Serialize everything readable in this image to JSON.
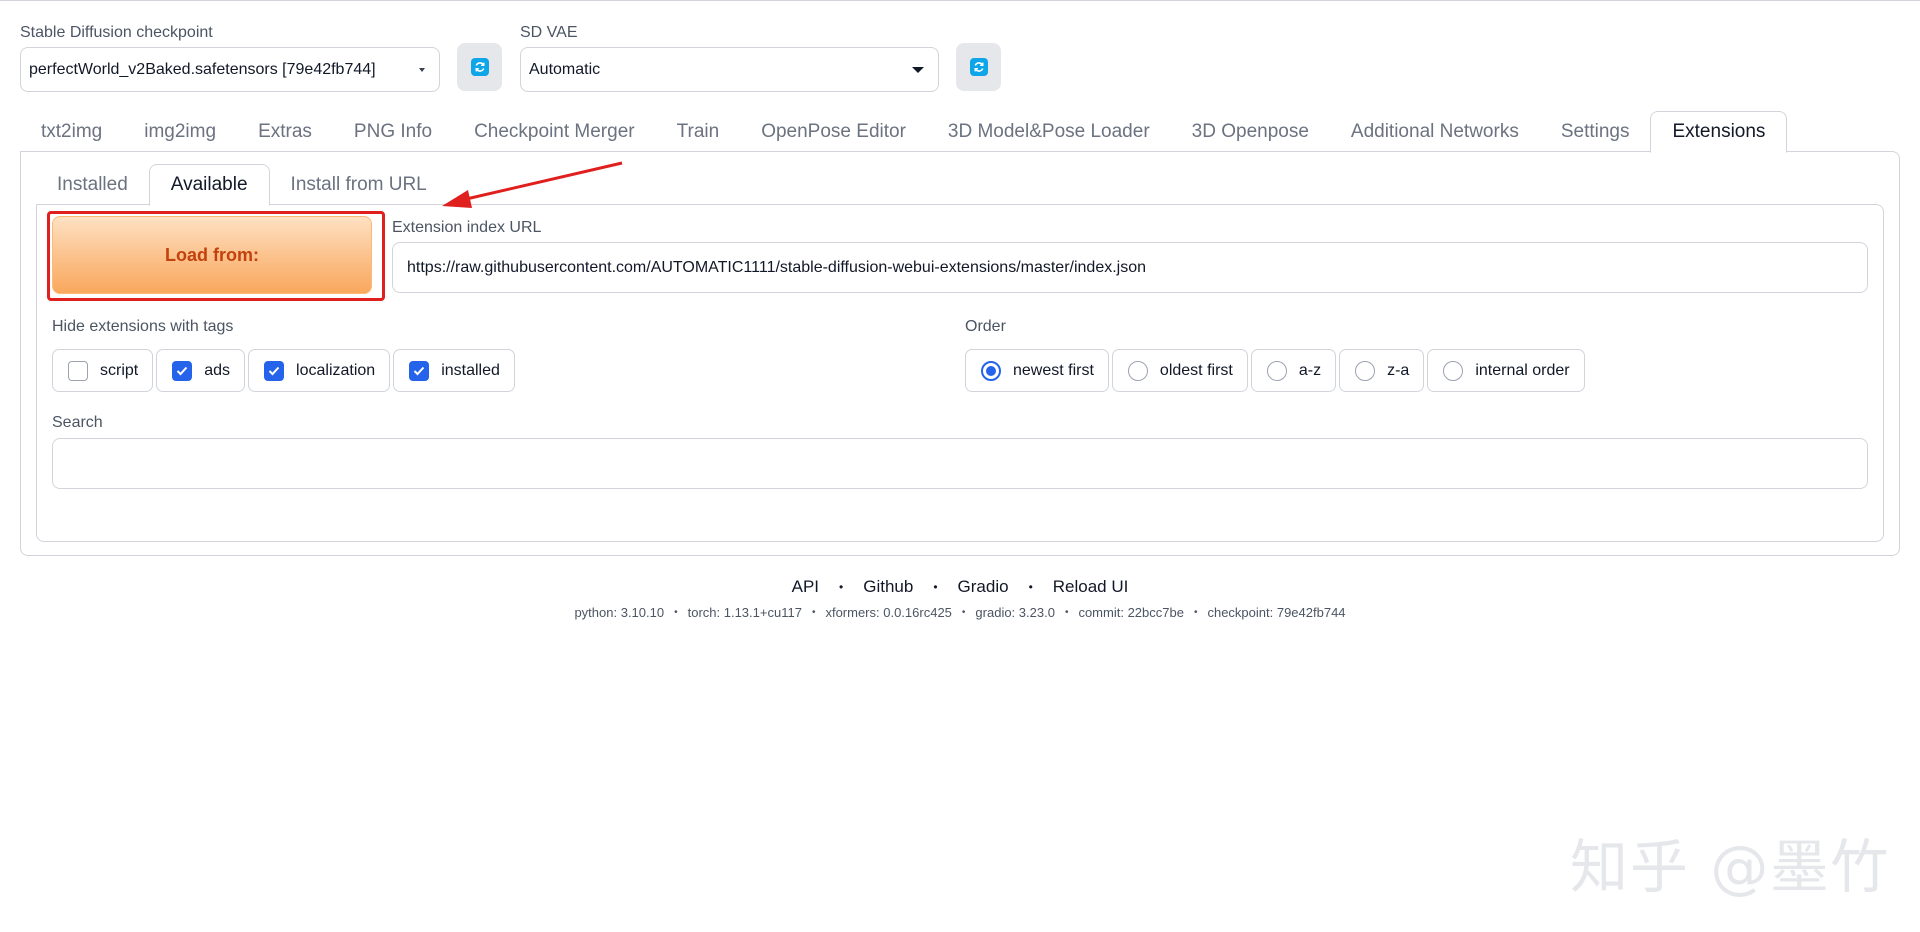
{
  "checkpoint": {
    "label": "Stable Diffusion checkpoint",
    "value": "perfectWorld_v2Baked.safetensors [79e42fb744]"
  },
  "vae": {
    "label": "SD VAE",
    "value": "Automatic"
  },
  "main_tabs": [
    "txt2img",
    "img2img",
    "Extras",
    "PNG Info",
    "Checkpoint Merger",
    "Train",
    "OpenPose Editor",
    "3D Model&Pose Loader",
    "3D Openpose",
    "Additional Networks",
    "Settings",
    "Extensions"
  ],
  "active_main_tab": "Extensions",
  "sub_tabs": [
    "Installed",
    "Available",
    "Install from URL"
  ],
  "active_sub_tab": "Available",
  "load_button": "Load from:",
  "extension_index": {
    "label": "Extension index URL",
    "value": "https://raw.githubusercontent.com/AUTOMATIC1111/stable-diffusion-webui-extensions/master/index.json"
  },
  "hide_tags": {
    "label": "Hide extensions with tags",
    "options": [
      {
        "label": "script",
        "checked": false
      },
      {
        "label": "ads",
        "checked": true
      },
      {
        "label": "localization",
        "checked": true
      },
      {
        "label": "installed",
        "checked": true
      }
    ]
  },
  "order": {
    "label": "Order",
    "options": [
      {
        "label": "newest first",
        "selected": true
      },
      {
        "label": "oldest first",
        "selected": false
      },
      {
        "label": "a-z",
        "selected": false
      },
      {
        "label": "z-a",
        "selected": false
      },
      {
        "label": "internal order",
        "selected": false
      }
    ]
  },
  "search": {
    "label": "Search",
    "value": ""
  },
  "footer": {
    "links": [
      "API",
      "Github",
      "Gradio",
      "Reload UI"
    ],
    "info": [
      "python: 3.10.10",
      "torch: 1.13.1+cu117",
      "xformers: 0.0.16rc425",
      "gradio: 3.23.0",
      "commit: 22bcc7be",
      "checkpoint: 79e42fb744"
    ]
  },
  "watermark": "知乎 @墨竹",
  "colors": {
    "accent": "#2563eb",
    "load_button": "#f9a85d",
    "highlight": "#e0201f",
    "refresh": "#0ea5e9"
  },
  "icons": {
    "refresh": "refresh-icon",
    "dropdown": "chevron-down-icon",
    "checkbox": "checkbox-icon",
    "radio": "radio-icon"
  }
}
